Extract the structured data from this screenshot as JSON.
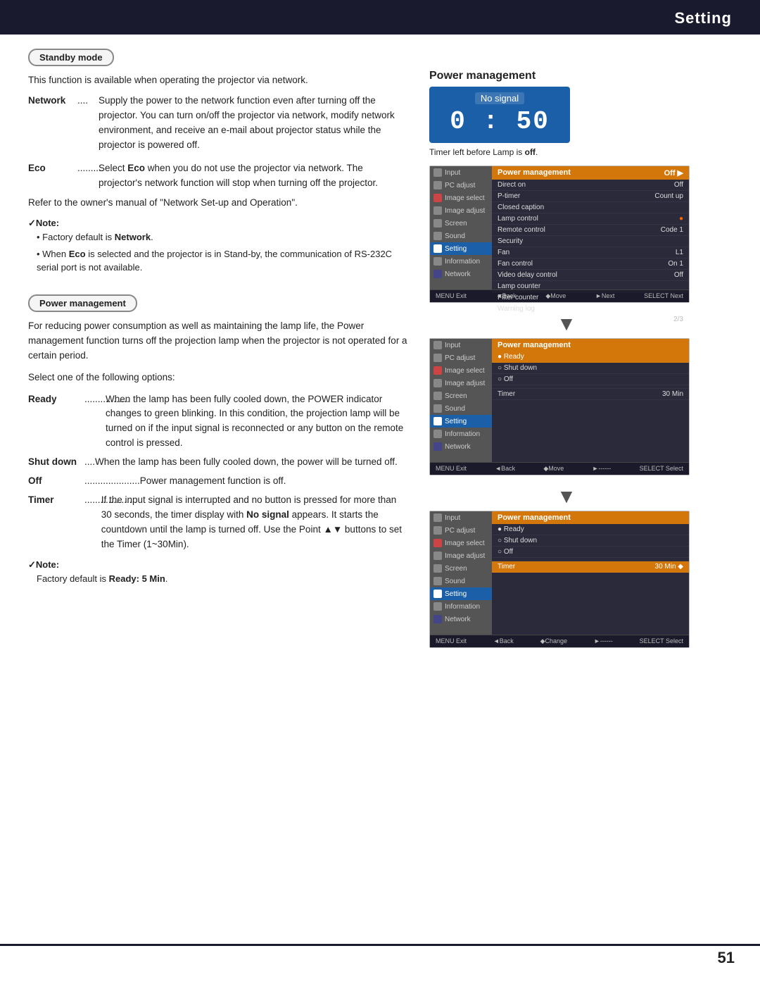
{
  "header": {
    "title": "Setting"
  },
  "page_number": "51",
  "left": {
    "standby_label": "Standby mode",
    "standby_intro": "This function is available when operating the projector via network.",
    "network_term": "Network",
    "network_dots": " ....",
    "network_desc": "Supply the power to the network function even after turning off the projector. You can turn on/off the projector via network, modify network environment, and receive an e-mail about projector status while the projector is powered off.",
    "eco_term": "Eco",
    "eco_dots": " ..........",
    "eco_desc": "Select Eco when you do not use the projector via network. The projector's network function will stop when turning off the projector.",
    "refer_text": "Refer to the owner's manual of \"Network Set-up and Operation\".",
    "note_label": "✓Note:",
    "note1": "• Factory default is Network.",
    "note2": "• When Eco is selected and the projector is in Stand-by, the communication of RS-232C serial port is not available.",
    "pm_label": "Power management",
    "pm_desc1": "For reducing power consumption as well as maintaining the lamp life, the Power management function turns off the projection lamp when the projector is not operated for a certain period.",
    "pm_desc2": "Select one of the following options:",
    "ready_term": "Ready",
    "ready_dots": "..................",
    "ready_desc": "When the lamp has been fully cooled down, the POWER indicator changes to green blinking. In this condition, the projection lamp will be turned on if the input signal is reconnected or any button on the remote control is pressed.",
    "shutdown_term": "Shut down",
    "shutdown_dots": " ..........",
    "shutdown_desc": "When the lamp has been fully cooled down, the power will be turned off.",
    "off_term": "Off",
    "off_dots": " ......................",
    "off_desc": "Power management function is off.",
    "timer_term": "Timer",
    "timer_dots": "....................",
    "timer_desc": "If the input signal is interrupted and no button is pressed for more than 30 seconds, the timer display with No signal appears. It starts the countdown until the lamp is turned off. Use the Point ▲▼ buttons to set the Timer (1~30Min).",
    "note2_label": "✓Note:",
    "note2_text": "Factory default is Ready: 5 Min."
  },
  "right": {
    "pm_section_title": "Power management",
    "no_signal": "No signal",
    "timer_display": "0 : 50",
    "timer_caption": "Timer left before Lamp is off.",
    "menus": [
      {
        "header_label": "Power management",
        "header_value": "Off ▶",
        "rows": [
          {
            "label": "Direct on",
            "value": "Off"
          },
          {
            "label": "P-timer",
            "value": "Count up"
          },
          {
            "label": "Closed caption",
            "value": ""
          },
          {
            "label": "Lamp control",
            "value": "●"
          },
          {
            "label": "Remote control",
            "value": "Code 1"
          },
          {
            "label": "Security",
            "value": ""
          },
          {
            "label": "Fan",
            "value": "L1"
          },
          {
            "label": "Fan control",
            "value": "On 1"
          },
          {
            "label": "Video delay control",
            "value": "Off"
          },
          {
            "label": "Lamp counter",
            "value": ""
          },
          {
            "label": "Filter counter",
            "value": ""
          },
          {
            "label": "Warning log",
            "value": ""
          }
        ],
        "page_indicator": "2/3",
        "footer": [
          "MENU Exit",
          "◄Back",
          "◆Move",
          "►Next",
          "SELECT Next"
        ]
      },
      {
        "header_label": "Power management",
        "header_value": "",
        "rows": [
          {
            "label": "● Ready",
            "value": "",
            "selected": true
          },
          {
            "label": "○ Shut down",
            "value": ""
          },
          {
            "label": "○ Off",
            "value": ""
          },
          {
            "label": "",
            "value": ""
          },
          {
            "label": "Timer",
            "value": "30 Min"
          }
        ],
        "footer": [
          "MENU Exit",
          "◄Back",
          "◆Move",
          "►------",
          "SELECT Select"
        ]
      },
      {
        "header_label": "Power management",
        "header_value": "",
        "rows": [
          {
            "label": "● Ready",
            "value": ""
          },
          {
            "label": "○ Shut down",
            "value": ""
          },
          {
            "label": "○ Off",
            "value": ""
          },
          {
            "label": "",
            "value": ""
          },
          {
            "label": "Timer",
            "value": "30 Min ◆",
            "selected": true
          }
        ],
        "footer": [
          "MENU Exit",
          "◄Back",
          "◆Change",
          "►------",
          "SELECT Select"
        ]
      }
    ],
    "sidebar_items": [
      {
        "label": "Input"
      },
      {
        "label": "PC adjust"
      },
      {
        "label": "Image select"
      },
      {
        "label": "Image adjust"
      },
      {
        "label": "Screen"
      },
      {
        "label": "Sound"
      },
      {
        "label": "Setting",
        "active": true
      },
      {
        "label": "Information"
      },
      {
        "label": "Network"
      }
    ]
  }
}
